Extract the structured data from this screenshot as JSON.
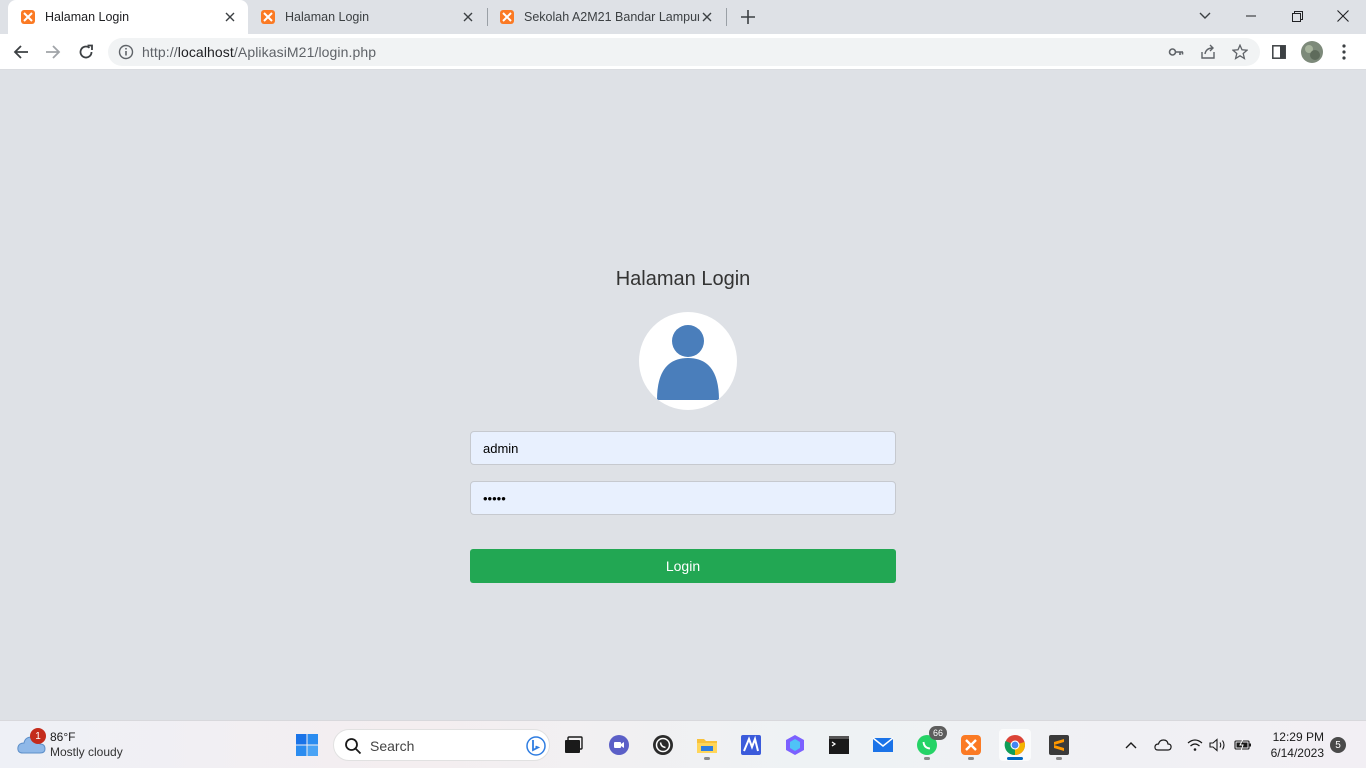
{
  "browser": {
    "tabs": [
      {
        "title": "Halaman Login",
        "active": true,
        "favicon": "xampp-icon"
      },
      {
        "title": "Halaman Login",
        "active": false,
        "favicon": "xampp-icon"
      },
      {
        "title": "Sekolah A2M21 Bandar Lampung",
        "active": false,
        "favicon": "xampp-icon"
      }
    ],
    "address_bar": {
      "scheme": "http://",
      "host": "localhost",
      "path": "/AplikasiM21/login.php"
    }
  },
  "login": {
    "title": "Halaman Login",
    "avatar_icon": "user-avatar-icon",
    "username_value": "admin",
    "password_value": "•••••",
    "submit_label": "Login"
  },
  "colors": {
    "page_background": "#dee1e6",
    "input_background": "#e8f0fe",
    "button_green": "#22a753",
    "avatar_blue": "#4a7ebb"
  },
  "taskbar": {
    "weather": {
      "badge": "1",
      "temperature": "86°F",
      "condition": "Mostly cloudy"
    },
    "search_placeholder": "Search",
    "whatsapp_badge": "66",
    "time": "12:29 PM",
    "date": "6/14/2023",
    "notification_count": "5",
    "pinned_apps": [
      "windows-start-icon",
      "search",
      "task-view-icon",
      "teams-chat-icon",
      "whatsapp-icon",
      "file-explorer-icon",
      "editor-icon",
      "copilot-icon",
      "terminal-icon",
      "mail-icon",
      "whatsapp-icon",
      "xampp-icon",
      "chrome-icon",
      "sublime-text-icon"
    ]
  }
}
